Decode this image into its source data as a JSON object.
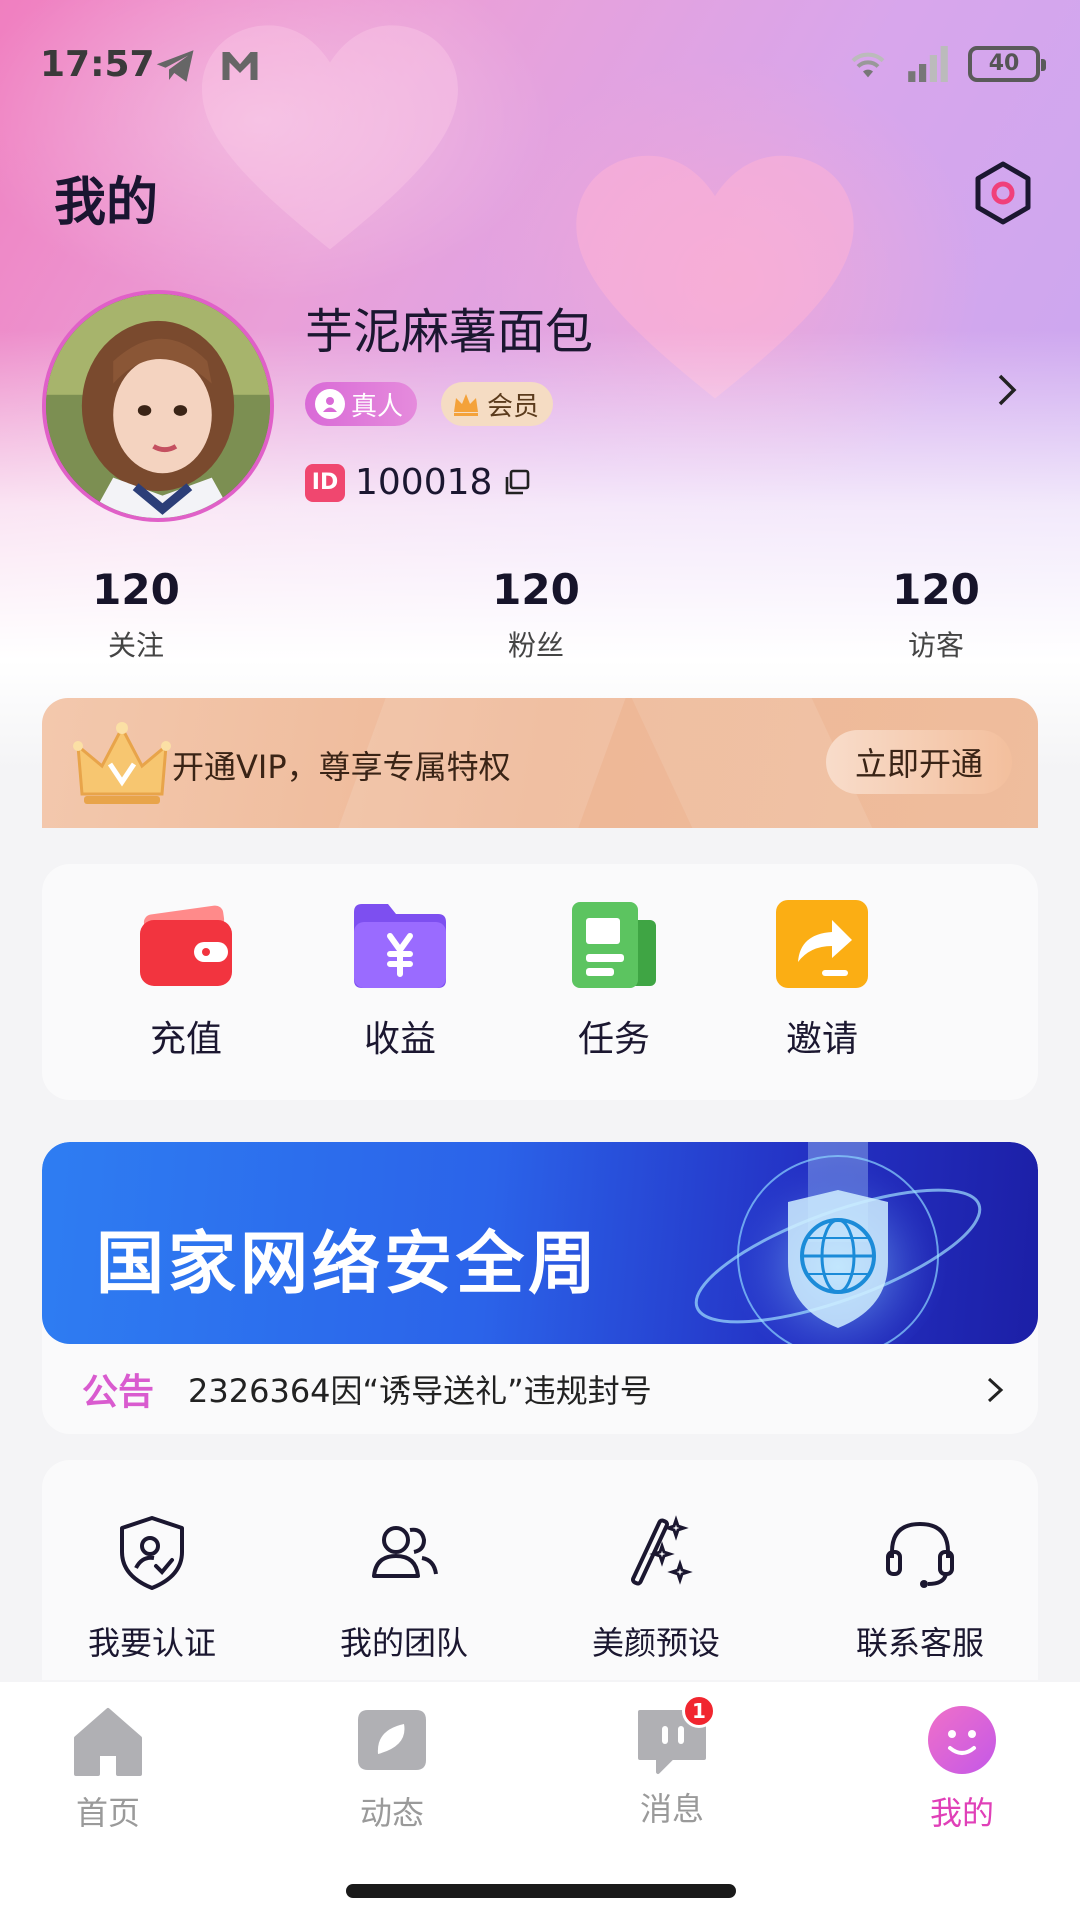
{
  "status": {
    "time": "17:57",
    "battery": "40"
  },
  "header": {
    "title": "我的",
    "settings_icon": "settings-icon"
  },
  "profile": {
    "nickname": "芋泥麻薯面包",
    "badges": [
      "真人",
      "会员"
    ],
    "id_tag": "ID",
    "id": "100018"
  },
  "stats": [
    {
      "value": "120",
      "label": "关注"
    },
    {
      "value": "120",
      "label": "粉丝"
    },
    {
      "value": "120",
      "label": "访客"
    }
  ],
  "vip": {
    "text": "开通VIP，尊享专属特权",
    "button": "立即开通"
  },
  "quick_actions": [
    "充值",
    "收益",
    "任务",
    "邀请"
  ],
  "banner": {
    "title": "国家网络安全周"
  },
  "notice": {
    "tag": "公告",
    "text": "2326364因“诱导送礼”违规封号"
  },
  "services": [
    "我要认证",
    "我的团队",
    "美颜预设",
    "联系客服"
  ],
  "tabs": [
    {
      "label": "首页",
      "icon": "home-icon"
    },
    {
      "label": "动态",
      "icon": "moments-icon"
    },
    {
      "label": "消息",
      "icon": "message-icon",
      "badge": "1"
    },
    {
      "label": "我的",
      "icon": "smiley-icon",
      "active": true
    }
  ],
  "colors": {
    "accent": "#e040b8",
    "badge_red": "#f1262f",
    "vip_bg": "#eeb796"
  }
}
